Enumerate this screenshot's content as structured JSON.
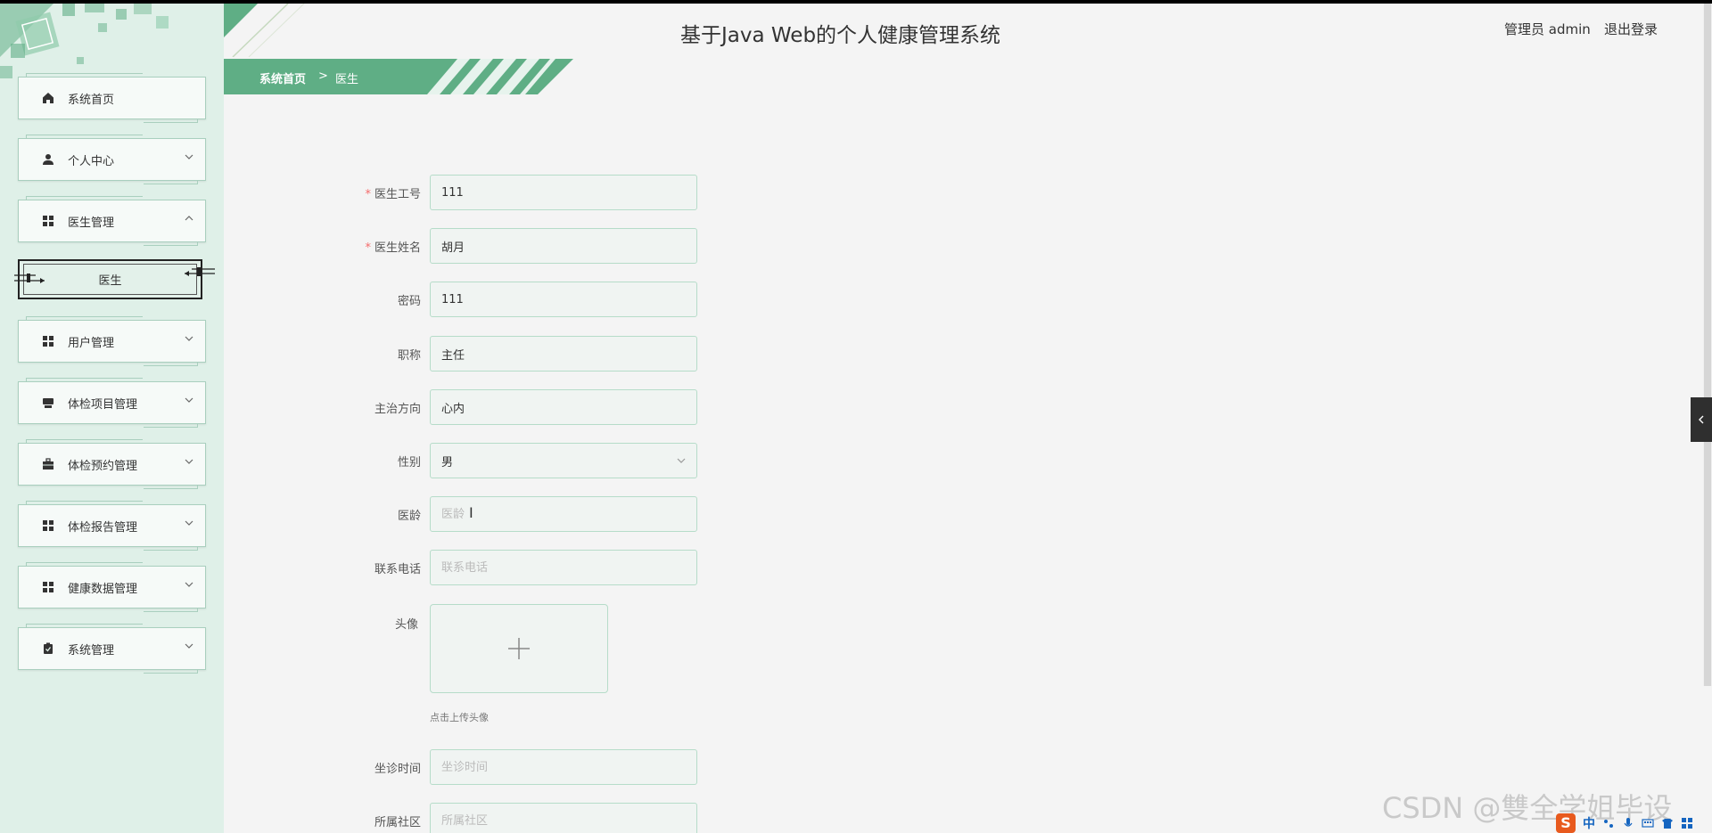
{
  "app": {
    "title": "基于Java Web的个人健康管理系统",
    "user_role": "管理员 admin",
    "logout": "退出登录"
  },
  "breadcrumb": {
    "home": "系统首页",
    "separator": ">",
    "current": "医生"
  },
  "sidebar": {
    "items": [
      {
        "label": "系统首页",
        "icon": "home-icon"
      },
      {
        "label": "个人中心",
        "icon": "person-icon"
      },
      {
        "label": "医生管理",
        "icon": "grid-icon",
        "expanded": true
      },
      {
        "label": "用户管理",
        "icon": "grid-icon"
      },
      {
        "label": "体检项目管理",
        "icon": "store-icon"
      },
      {
        "label": "体检预约管理",
        "icon": "briefcase-icon"
      },
      {
        "label": "体检报告管理",
        "icon": "grid-icon"
      },
      {
        "label": "健康数据管理",
        "icon": "grid-icon"
      },
      {
        "label": "系统管理",
        "icon": "clipboard-icon"
      }
    ],
    "submenu": {
      "label": "医生"
    }
  },
  "form": {
    "doctor_id": {
      "label": "医生工号",
      "value": "111"
    },
    "doctor_name": {
      "label": "医生姓名",
      "value": "胡月"
    },
    "password": {
      "label": "密码",
      "value": "111"
    },
    "title": {
      "label": "职称",
      "value": "主任"
    },
    "specialty": {
      "label": "主治方向",
      "value": "心内"
    },
    "gender": {
      "label": "性别",
      "value": "男"
    },
    "seniority": {
      "label": "医龄",
      "placeholder": "医龄"
    },
    "phone": {
      "label": "联系电话",
      "placeholder": "联系电话"
    },
    "avatar": {
      "label": "头像",
      "tip": "点击上传头像"
    },
    "clinic_time": {
      "label": "坐诊时间",
      "placeholder": "坐诊时间"
    },
    "community": {
      "label": "所属社区",
      "placeholder": "所属社区"
    }
  },
  "watermark": "CSDN @雙全学姐毕设",
  "tray": {
    "ime_logo": "S",
    "ime_lang": "中"
  },
  "colors": {
    "brand_green": "#5fae85",
    "sidebar_bg": "#dff0e8",
    "input_border": "#b6dcc9",
    "required": "#f56c6c"
  }
}
